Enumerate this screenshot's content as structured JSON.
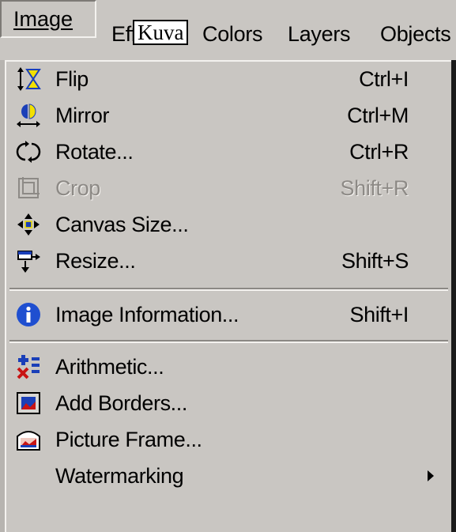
{
  "menubar": {
    "items": [
      {
        "label": "Image"
      },
      {
        "label": "Eff"
      },
      {
        "label": "Colors"
      },
      {
        "label": "Layers"
      },
      {
        "label": "Objects"
      }
    ],
    "tooltip": "Kuva"
  },
  "menu": {
    "items": [
      {
        "label": "Flip",
        "shortcut": "Ctrl+I",
        "icon": "flip-icon",
        "enabled": true
      },
      {
        "label": "Mirror",
        "shortcut": "Ctrl+M",
        "icon": "mirror-icon",
        "enabled": true
      },
      {
        "label": "Rotate...",
        "shortcut": "Ctrl+R",
        "icon": "rotate-icon",
        "enabled": true
      },
      {
        "label": "Crop",
        "shortcut": "Shift+R",
        "icon": "crop-icon",
        "enabled": false
      },
      {
        "label": "Canvas Size...",
        "shortcut": "",
        "icon": "canvas-size-icon",
        "enabled": true
      },
      {
        "label": "Resize...",
        "shortcut": "Shift+S",
        "icon": "resize-icon",
        "enabled": true
      },
      {
        "label": "Image Information...",
        "shortcut": "Shift+I",
        "icon": "info-icon",
        "enabled": true
      },
      {
        "label": "Arithmetic...",
        "shortcut": "",
        "icon": "arithmetic-icon",
        "enabled": true
      },
      {
        "label": "Add Borders...",
        "shortcut": "",
        "icon": "add-borders-icon",
        "enabled": true
      },
      {
        "label": "Picture Frame...",
        "shortcut": "",
        "icon": "picture-frame-icon",
        "enabled": true
      },
      {
        "label": "Watermarking",
        "shortcut": "",
        "icon": "",
        "enabled": true,
        "submenu": true
      }
    ]
  },
  "colors": {
    "menu_bg": "#c9c6c2",
    "disabled_text": "#8d8a86",
    "info_blue": "#1f4fd0",
    "flip_yellow": "#f2e000",
    "arrow_blue": "#1a3fb8",
    "arrow_red": "#c81414"
  }
}
